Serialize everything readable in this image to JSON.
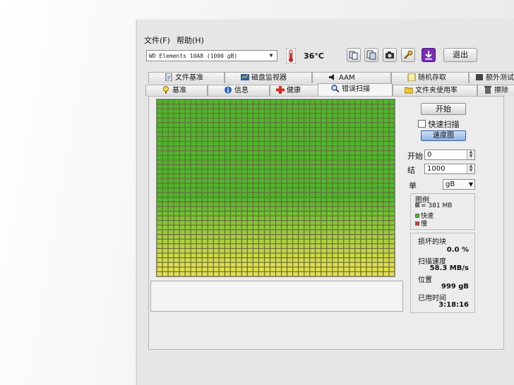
{
  "menu": {
    "file": "文件(F)",
    "help": "帮助(H)"
  },
  "toolbar": {
    "drive": "WD   Elements 10A8 (1000 gB)",
    "temperature": "36°C",
    "exit_label": "退出"
  },
  "tabs_row1": [
    {
      "label": "文件基准",
      "icon": "file-benchmark-icon"
    },
    {
      "label": "磁盘监视器",
      "icon": "disk-monitor-icon"
    },
    {
      "label": "AAM",
      "icon": "speaker-icon"
    },
    {
      "label": "随机存取",
      "icon": "random-access-icon"
    },
    {
      "label": "额外测试",
      "icon": "extra-tests-icon"
    }
  ],
  "tabs_row2": [
    {
      "label": "基准",
      "icon": "benchmark-icon"
    },
    {
      "label": "信息",
      "icon": "info-icon"
    },
    {
      "label": "健康",
      "icon": "health-cross-icon"
    },
    {
      "label": "错误扫描",
      "icon": "magnifier-icon"
    },
    {
      "label": "文件夹使用率",
      "icon": "folder-icon"
    },
    {
      "label": "擦除",
      "icon": "trash-icon"
    }
  ],
  "scan": {
    "start_button": "开始",
    "quick_scan_label": "快速扫描",
    "speed_map_button": "速度图",
    "start_label": "开始",
    "start_value": "0",
    "end_label": "结",
    "end_value": "1000",
    "unit_label": "单",
    "unit_value": "gB"
  },
  "legend": {
    "title": "图例",
    "block_size": "= 381 MB",
    "fast": "快速",
    "slow": "慢"
  },
  "stats": {
    "damaged_label": "损坏的块",
    "damaged_value": "0.0 %",
    "speed_label": "扫描速度",
    "speed_value": "58.3 MB/s",
    "position_label": "位置",
    "position_value": "999 gB",
    "elapsed_label": "已用时间",
    "elapsed_value": "3:18:16"
  },
  "colors": {
    "fast_green": "#4db82a",
    "fast_yellow": "#e3e04a",
    "slow_red": "#e0322a",
    "block_gray": "#777777"
  },
  "scan_grid": {
    "columns": 42,
    "rows": 38,
    "blocks_scanned_fraction": 1.0
  }
}
